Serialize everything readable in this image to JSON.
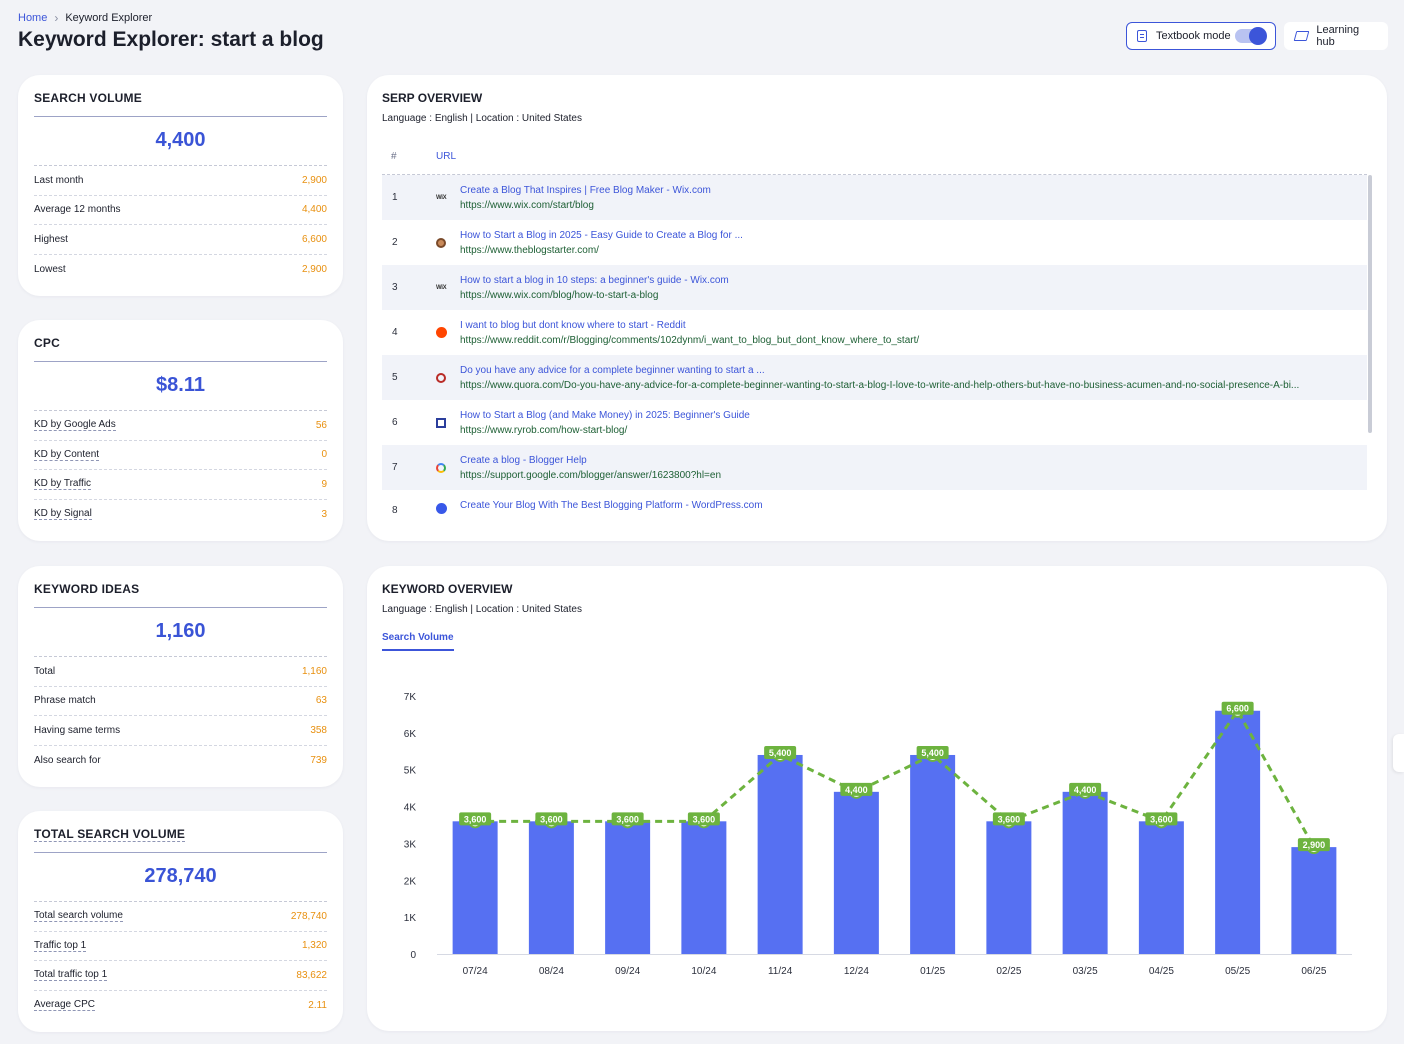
{
  "breadcrumb": {
    "home": "Home",
    "sep": "›",
    "current": "Keyword Explorer"
  },
  "title": {
    "prefix": "Keyword Explorer:",
    "keyword": "start a blog"
  },
  "actions": {
    "textbook_label": "Textbook mode",
    "textbook_on": true,
    "learning_label": "Learning hub"
  },
  "search_volume": {
    "title": "SEARCH VOLUME",
    "value": "4,400",
    "rows": [
      {
        "label": "Last month",
        "value": "2,900"
      },
      {
        "label": "Average 12 months",
        "value": "4,400"
      },
      {
        "label": "Highest",
        "value": "6,600"
      },
      {
        "label": "Lowest",
        "value": "2,900"
      }
    ]
  },
  "cpc": {
    "title": "CPC",
    "value": "$8.11",
    "rows": [
      {
        "label": "KD by Google Ads",
        "value": "56"
      },
      {
        "label": "KD by Content",
        "value": "0"
      },
      {
        "label": "KD by Traffic",
        "value": "9"
      },
      {
        "label": "KD by Signal",
        "value": "3"
      }
    ]
  },
  "keyword_ideas": {
    "title": "KEYWORD IDEAS",
    "value": "1,160",
    "rows": [
      {
        "label": "Total",
        "value": "1,160"
      },
      {
        "label": "Phrase match",
        "value": "63"
      },
      {
        "label": "Having same terms",
        "value": "358"
      },
      {
        "label": "Also search for",
        "value": "739"
      }
    ]
  },
  "total_search_volume": {
    "title": "TOTAL SEARCH VOLUME",
    "value": "278,740",
    "rows": [
      {
        "label": "Total search volume",
        "value": "278,740"
      },
      {
        "label": "Traffic top 1",
        "value": "1,320"
      },
      {
        "label": "Total traffic top 1",
        "value": "83,622"
      },
      {
        "label": "Average CPC",
        "value": "2.11"
      }
    ]
  },
  "serp": {
    "title": "SERP OVERVIEW",
    "subtitle": "Language : English | Location : United States",
    "col_num": "#",
    "col_url": "URL",
    "rows": [
      {
        "num": "1",
        "icon": "wix-icon",
        "favtext": "WiX",
        "title": "Create a Blog That Inspires | Free Blog Maker - Wix.com",
        "url": "https://www.wix.com/start/blog"
      },
      {
        "num": "2",
        "icon": "blogstarter-avatar-icon",
        "favtext": "",
        "title": "How to Start a Blog in 2025 - Easy Guide to Create a Blog for ...",
        "url": "https://www.theblogstarter.com/"
      },
      {
        "num": "3",
        "icon": "wix-icon",
        "favtext": "WiX",
        "title": "How to start a blog in 10 steps: a beginner's guide - Wix.com",
        "url": "https://www.wix.com/blog/how-to-start-a-blog"
      },
      {
        "num": "4",
        "icon": "reddit-icon",
        "favtext": "",
        "title": "I want to blog but dont know where to start - Reddit",
        "url": "https://www.reddit.com/r/Blogging/comments/102dynm/i_want_to_blog_but_dont_know_where_to_start/"
      },
      {
        "num": "5",
        "icon": "quora-icon",
        "favtext": "",
        "title": "Do you have any advice for a complete beginner wanting to start a ...",
        "url": "https://www.quora.com/Do-you-have-any-advice-for-a-complete-beginner-wanting-to-start-a-blog-I-love-to-write-and-help-others-but-have-no-business-acumen-and-no-social-presence-A-bi..."
      },
      {
        "num": "6",
        "icon": "ryrob-icon",
        "favtext": "",
        "title": "How to Start a Blog (and Make Money) in 2025: Beginner's Guide",
        "url": "https://www.ryrob.com/how-start-blog/"
      },
      {
        "num": "7",
        "icon": "google-icon",
        "favtext": "",
        "title": "Create a blog - Blogger Help",
        "url": "https://support.google.com/blogger/answer/1623800?hl=en"
      },
      {
        "num": "8",
        "icon": "wordpress-icon",
        "favtext": "",
        "title": "Create Your Blog With The Best Blogging Platform - WordPress.com",
        "url": ""
      }
    ]
  },
  "keyword_overview": {
    "title": "KEYWORD OVERVIEW",
    "subtitle": "Language : English | Location : United States",
    "tab": "Search Volume"
  },
  "chart_data": {
    "type": "bar",
    "categories": [
      "07/24",
      "08/24",
      "09/24",
      "10/24",
      "11/24",
      "12/24",
      "01/25",
      "02/25",
      "03/25",
      "04/25",
      "05/25",
      "06/25"
    ],
    "values": [
      3600,
      3600,
      3600,
      3600,
      5400,
      4400,
      5400,
      3600,
      4400,
      3600,
      6600,
      2900
    ],
    "data_labels": [
      "3,600",
      "3,600",
      "3,600",
      "3,600",
      "5,400",
      "4,400",
      "5,400",
      "3,600",
      "4,400",
      "3,600",
      "6,600",
      "2,900"
    ],
    "yticks": [
      0,
      1000,
      2000,
      3000,
      4000,
      5000,
      6000,
      7000
    ],
    "ytick_labels": [
      "0",
      "1K",
      "2K",
      "3K",
      "4K",
      "5K",
      "6K",
      "7K"
    ],
    "ylim": [
      0,
      7000
    ],
    "overlay": "dashed line through bar tops",
    "colors": {
      "bar": "#5670f2",
      "line": "#6db33f",
      "label_bg": "#6db33f"
    }
  },
  "colors": {
    "accent": "#3c55d9",
    "value_orange": "#e8900f",
    "url_green": "#1d5f34"
  }
}
